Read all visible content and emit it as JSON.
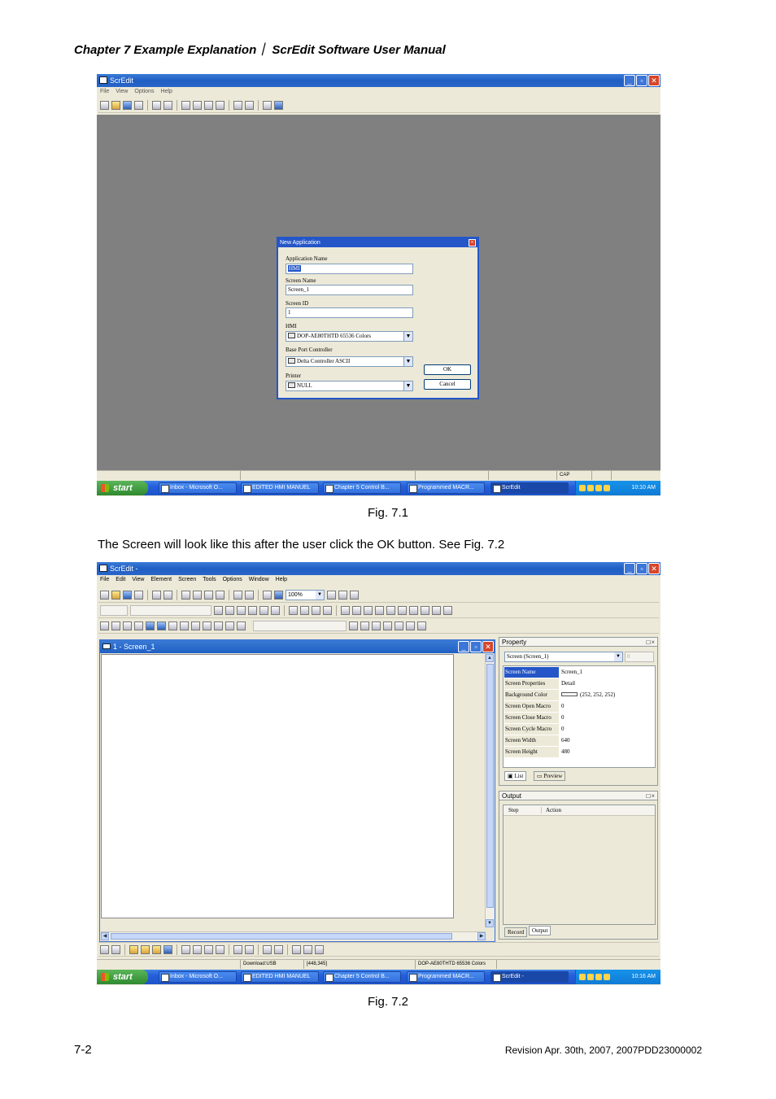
{
  "header": "Chapter 7  Example Explanation｜ ScrEdit Software User Manual",
  "fig1": {
    "caption": "Fig. 7.1",
    "window_title": "ScrEdit",
    "menu": [
      "File",
      "View",
      "Options",
      "Help"
    ],
    "status": {
      "cap": "CAP"
    },
    "dialog": {
      "title": "New Application",
      "app_name_label": "Application Name",
      "app_name_value": "HMI",
      "screen_name_label": "Screen Name",
      "screen_name_value": "Screen_1",
      "screen_id_label": "Screen ID",
      "screen_id_value": "1",
      "hmi_label": "HMI",
      "hmi_value": "DOP-AE80THTD 65536 Colors",
      "controller_label": "Base Port Controller",
      "controller_value": "Delta Controller ASCII",
      "printer_label": "Printer",
      "printer_value": "NULL",
      "ok": "OK",
      "cancel": "Cancel"
    },
    "taskbar": {
      "start": "start",
      "tasks": [
        "Inbox - Microsoft O...",
        "EDITED HMI MANUEL",
        "Chapter 5 Control B...",
        "Programmed MACR...",
        "ScrEdit"
      ],
      "clock": "10:10 AM"
    }
  },
  "body_text": "The Screen will look like this after the user click the OK button. See Fig. 7.2",
  "fig2": {
    "caption": "Fig. 7.2",
    "window_title": "ScrEdit -",
    "menu": [
      "File",
      "Edit",
      "View",
      "Element",
      "Screen",
      "Tools",
      "Options",
      "Window",
      "Help"
    ],
    "zoom": "100%",
    "mdi_title": "1 - Screen_1",
    "property": {
      "title": "Property",
      "selector": "Screen (Screen_1)",
      "selector_num": "0",
      "rows": [
        {
          "name": "Screen Name",
          "value": "Screen_1"
        },
        {
          "name": "Screen Properties",
          "value": "Detail"
        },
        {
          "name": "Background Color",
          "value": "(252, 252, 252)"
        },
        {
          "name": "Screen Open Macro",
          "value": "0"
        },
        {
          "name": "Screen Close Macro",
          "value": "0"
        },
        {
          "name": "Screen Cycle Macro",
          "value": "0"
        },
        {
          "name": "Screen Width",
          "value": "640"
        },
        {
          "name": "Screen Height",
          "value": "480"
        }
      ],
      "tab_list": "List",
      "tab_preview": "Preview"
    },
    "output": {
      "title": "Output",
      "col_step": "Step",
      "col_action": "Action",
      "tab_record": "Record",
      "tab_output": "Output"
    },
    "status": {
      "download": "Download:USB",
      "coords": "[448,345]",
      "model": "DOP-AE80THTD 65536 Colors"
    },
    "taskbar": {
      "start": "start",
      "tasks": [
        "Inbox - Microsoft O...",
        "EDITED HMI MANUEL",
        "Chapter 5 Control B...",
        "Programmed MACR...",
        "ScrEdit -"
      ],
      "clock": "10:16 AM"
    }
  },
  "footer": {
    "page": "7-2",
    "revision": "Revision Apr. 30th, 2007, 2007PDD23000002"
  }
}
